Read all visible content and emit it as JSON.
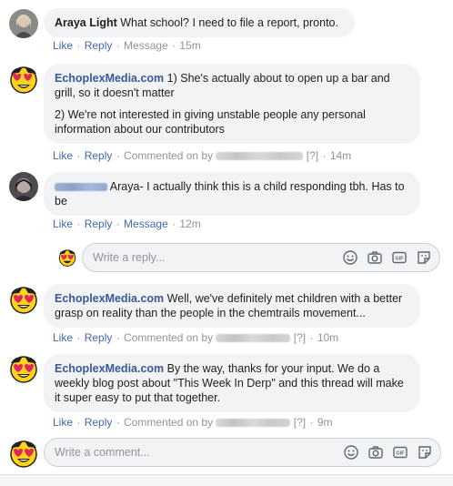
{
  "comments": [
    {
      "author": "Araya Light",
      "text": "What school? I need to file a report, pronto.",
      "like": "Like",
      "reply": "Reply",
      "extra": "Message",
      "time": "15m"
    },
    {
      "author": "EchoplexMedia.com",
      "text": "1) She's actually about to open up a bar and grill, so it doesn't matter",
      "text2": "2) We're not interested in giving unstable people any personal information about our contributors",
      "like": "Like",
      "reply": "Reply",
      "commented_on": "Commented on by",
      "hidden_tag": "[?]",
      "time": "14m"
    },
    {
      "author_hidden": true,
      "text": "Araya- I actually think this is a child responding tbh. Has to be",
      "like": "Like",
      "reply": "Reply",
      "extra": "Message",
      "time": "12m"
    },
    {
      "author": "EchoplexMedia.com",
      "text": "Well, we've definitely met children with a better grasp on reality than the people in the chemtrails movement...",
      "like": "Like",
      "reply": "Reply",
      "commented_on": "Commented on by",
      "hidden_tag": "[?]",
      "time": "10m"
    },
    {
      "author": "EchoplexMedia.com",
      "text": "By the way, thanks for your input. We do a weekly blog post about \"This Week In Derp\" and this thread will make it super easy to put that together.",
      "like": "Like",
      "reply": "Reply",
      "commented_on": "Commented on by",
      "hidden_tag": "[?]",
      "time": "9m"
    }
  ],
  "reply_box": {
    "placeholder": "Write a reply..."
  },
  "comment_box": {
    "placeholder": "Write a comment..."
  },
  "composer_icons": [
    "emoji-icon",
    "camera-icon",
    "gif-icon",
    "sticker-icon"
  ],
  "colors": {
    "link": "#4267b2",
    "author": "#385898",
    "bubble": "#f2f3f5",
    "meta": "#90949c"
  }
}
